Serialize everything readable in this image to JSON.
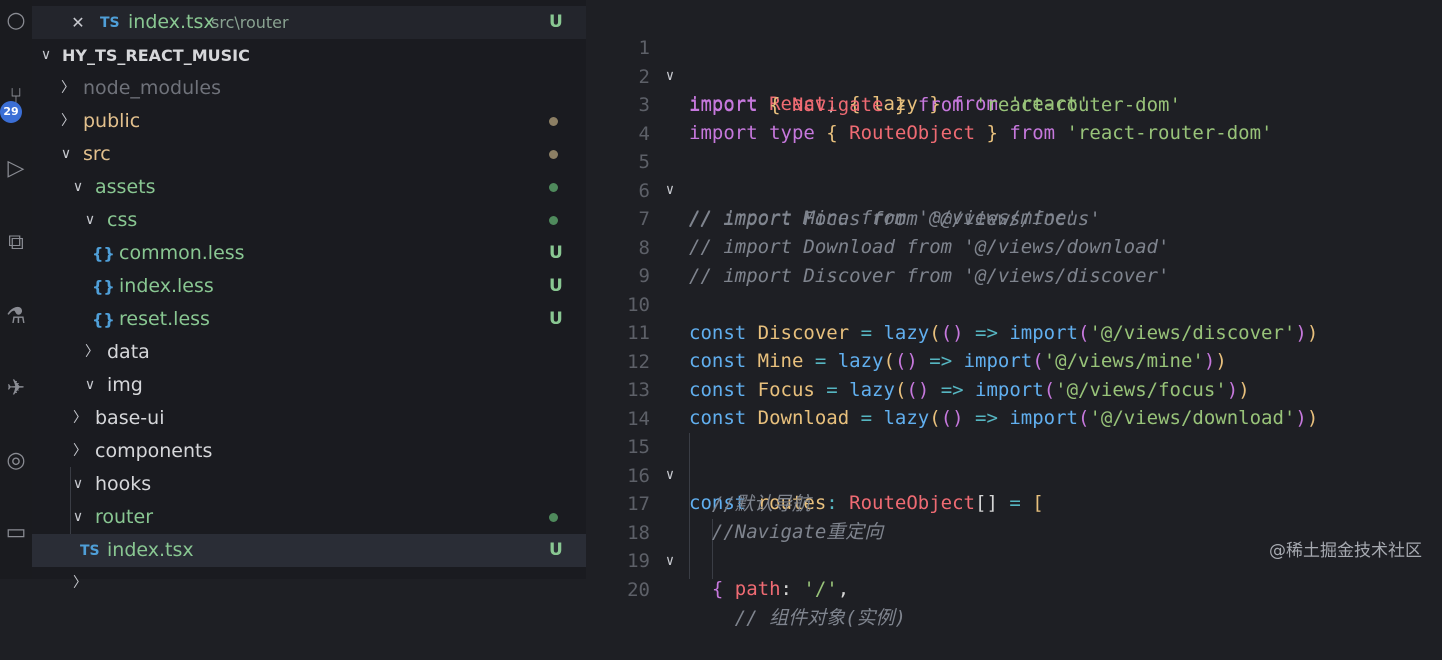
{
  "activity_bar": {
    "badge": "29"
  },
  "open_editor": {
    "type_badge": "TS",
    "file": "index.tsx",
    "path": "src\\router",
    "status": "U"
  },
  "explorer": {
    "title": "HY_TS_REACT_MUSIC",
    "items": [
      {
        "label": "node_modules"
      },
      {
        "label": "public"
      },
      {
        "label": "src"
      },
      {
        "label": "assets"
      },
      {
        "label": "css"
      },
      {
        "label": "common.less",
        "icon": "{}",
        "status": "U"
      },
      {
        "label": "index.less",
        "icon": "{}",
        "status": "U"
      },
      {
        "label": "reset.less",
        "icon": "{}",
        "status": "U"
      },
      {
        "label": "data"
      },
      {
        "label": "img"
      },
      {
        "label": "base-ui"
      },
      {
        "label": "components"
      },
      {
        "label": "hooks"
      },
      {
        "label": "router"
      },
      {
        "label": "index.tsx",
        "icon": "TS",
        "status": "U"
      }
    ]
  },
  "editor": {
    "line_numbers": [
      "1",
      "2",
      "3",
      "4",
      "5",
      "6",
      "7",
      "8",
      "9",
      "10",
      "11",
      "12",
      "13",
      "14",
      "15",
      "16",
      "17",
      "18",
      "19",
      "20"
    ],
    "lines": [
      [
        "import",
        " React",
        ", ",
        "{",
        " lazy ",
        "}",
        " from ",
        "'react'"
      ],
      [
        "import",
        " ",
        "{",
        " Navigate ",
        "}",
        " from ",
        "'react-router-dom'"
      ],
      [
        "import",
        " type ",
        "{",
        " RouteObject ",
        "}",
        " from ",
        "'react-router-dom'"
      ],
      [],
      [
        "// import Mine from '@/views/mine'"
      ],
      [
        "// import Focus from '@/views/focus'"
      ],
      [
        "// import Download from '@/views/download'"
      ],
      [
        "// import Discover from '@/views/discover'"
      ],
      [],
      [
        "const",
        " Discover",
        " = ",
        "lazy",
        "(",
        "()",
        " => ",
        "import",
        "(",
        "'@/views/discover'",
        ")",
        ")"
      ],
      [
        "const",
        " Mine",
        " = ",
        "lazy",
        "(",
        "()",
        " => ",
        "import",
        "(",
        "'@/views/mine'",
        ")",
        ")"
      ],
      [
        "const",
        " Focus",
        " = ",
        "lazy",
        "(",
        "()",
        " => ",
        "import",
        "(",
        "'@/views/focus'",
        ")",
        ")"
      ],
      [
        "const",
        " Download",
        " = ",
        "lazy",
        "(",
        "()",
        " => ",
        "import",
        "(",
        "'@/views/download'",
        ")",
        ")"
      ],
      [],
      [
        "const",
        " routes",
        ": ",
        "RouteObject",
        "[]",
        " = ",
        "["
      ],
      [
        "  //默认导航"
      ],
      [
        "  //Navigate重定向"
      ],
      [
        "  ",
        "{"
      ],
      [
        "    ",
        "path",
        ": ",
        "'/'",
        ","
      ],
      [
        "    // 组件对象(实例)"
      ]
    ]
  },
  "watermark": "@稀土掘金技术社区"
}
